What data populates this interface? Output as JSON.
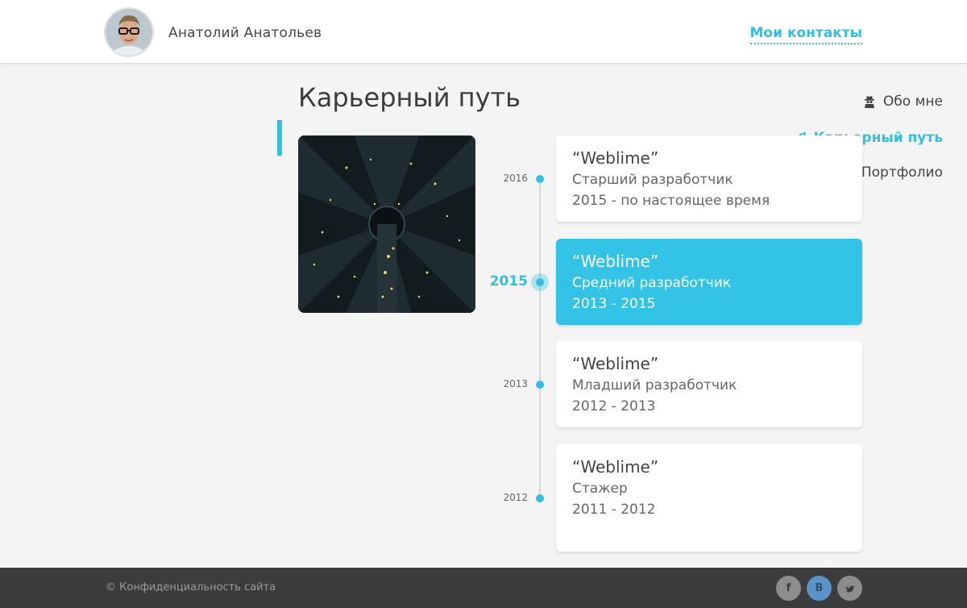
{
  "header": {
    "user_name": "Анатолий Анатольев",
    "contacts_link": "Мои контакты"
  },
  "sidebar": {
    "items": [
      {
        "label": "Обо мне",
        "icon": "user-secret-icon",
        "active": false
      },
      {
        "label": "Карьерный путь",
        "icon": "rocket-icon",
        "active": true
      },
      {
        "label": "Портфолио",
        "icon": "briefcase-icon",
        "active": false
      }
    ]
  },
  "main": {
    "title": "Карьерный путь"
  },
  "timeline": [
    {
      "year": "2016",
      "company": "“Weblime”",
      "role": "Старший разработчик",
      "period": "2015 - по настоящее время",
      "active": false
    },
    {
      "year": "2015",
      "company": "“Weblime”",
      "role": "Средний разработчик",
      "period": "2013 - 2015",
      "active": true
    },
    {
      "year": "2013",
      "company": "“Weblime”",
      "role": "Младший разработчик",
      "period": "2012 - 2013",
      "active": false
    },
    {
      "year": "2012",
      "company": "“Weblime”",
      "role": "Стажер",
      "period": "2011 - 2012",
      "active": false
    }
  ],
  "footer": {
    "copyright": "© Конфиденциальность сайта",
    "social": [
      {
        "label": "f",
        "icon": "facebook-icon"
      },
      {
        "label": "В",
        "icon": "vk-icon"
      },
      {
        "label": "",
        "icon": "twitter-icon"
      }
    ]
  },
  "colors": {
    "accent": "#31bfe2",
    "active_card": "#33c3e6",
    "footer_bg": "#3c3c3c",
    "page_bg": "#f4f4f4"
  }
}
